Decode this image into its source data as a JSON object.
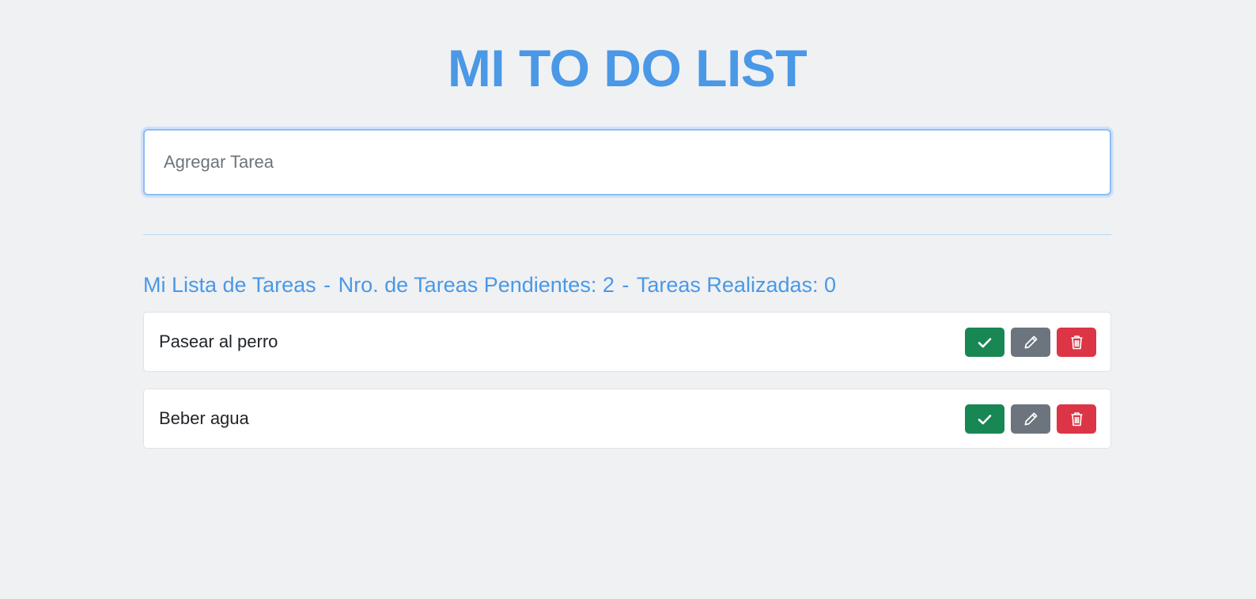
{
  "header": {
    "title": "MI TO DO LIST"
  },
  "input": {
    "placeholder": "Agregar Tarea",
    "value": ""
  },
  "summary": {
    "label": "Mi Lista de Tareas",
    "pending_label": "Nro. de Tareas Pendientes:",
    "pending_count": "2",
    "done_label": "Tareas Realizadas:",
    "done_count": "0"
  },
  "tasks": [
    {
      "text": "Pasear al perro"
    },
    {
      "text": "Beber agua"
    }
  ],
  "task_actions": {
    "complete_icon": "check-icon",
    "edit_icon": "pencil-icon",
    "delete_icon": "trash-icon"
  },
  "colors": {
    "accent": "#4a98e6",
    "complete": "#198754",
    "edit": "#6c757d",
    "delete": "#dc3545",
    "background": "#f0f1f3"
  }
}
